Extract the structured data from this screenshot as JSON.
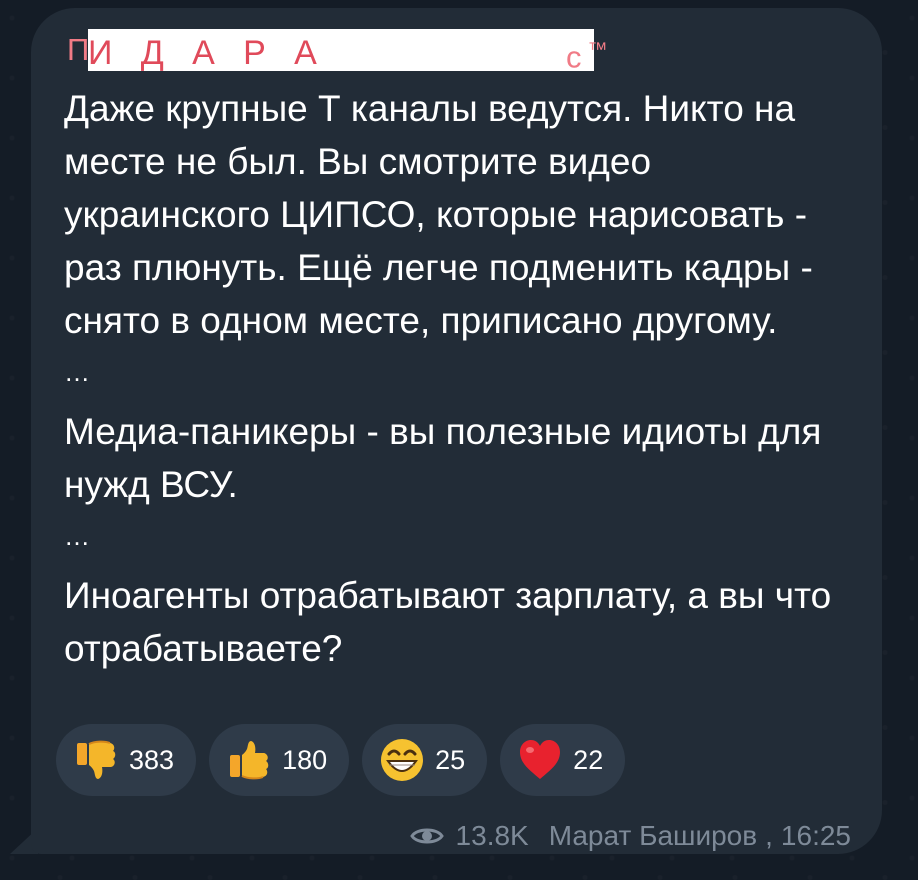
{
  "message": {
    "sender_visible_start": "П",
    "sender_redacted_letters": "И   Д   А   Р   А",
    "sender_visible_end": "с",
    "sender_mark": "™",
    "paragraphs": [
      "Даже крупные Т каналы ведутся. Никто на месте не был. Вы смотрите видео украинского ЦИПСО, которые нарисовать - раз плюнуть. Ещё легче подменить кадры - снято в одном месте, приписано другому.",
      "…",
      "Медиа-паникеры - вы полезные идиоты для нужд ВСУ.",
      "…",
      "Иноагенты отрабатывают зарплату, а вы что отрабатываете?"
    ]
  },
  "reactions": [
    {
      "icon": "thumbs-down-icon",
      "count": "383"
    },
    {
      "icon": "thumbs-up-icon",
      "count": "180"
    },
    {
      "icon": "grinning-face-icon",
      "count": "25"
    },
    {
      "icon": "heart-icon",
      "count": "22"
    }
  ],
  "footer": {
    "views": "13.8K",
    "author": "Марат Баширов",
    "time": "16:25",
    "separator": ","
  },
  "colors": {
    "background": "#141c26",
    "bubble": "#222c37",
    "reaction_pill": "#2f3b49",
    "sender": "#f07b86",
    "text": "#ffffff",
    "meta": "#7e8a98"
  }
}
